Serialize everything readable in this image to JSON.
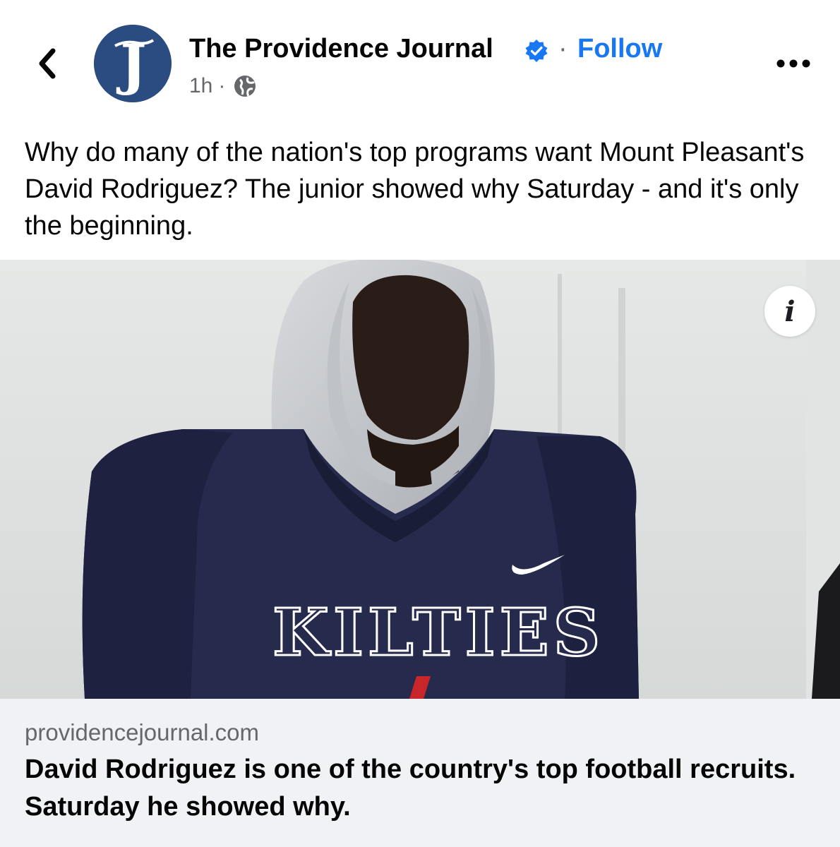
{
  "post": {
    "page_name": "The Providence Journal",
    "follow_label": "Follow",
    "separator": "·",
    "timestamp": "1h",
    "meta_separator": "·",
    "avatar_letter": "J",
    "text": "Why do many of the nation's top programs want Mount Pleasant's David Rodriguez? The junior showed why Saturday - and it's only the beginning."
  },
  "photo": {
    "jersey_text": "KILTIES",
    "info_icon": "i"
  },
  "link": {
    "domain": "providencejournal.com",
    "headline": "David Rodriguez is one of the country's top football recruits. Saturday he showed why."
  },
  "colors": {
    "accent": "#1877f2",
    "secondary_text": "#65676b",
    "jersey_navy": "#262a4c",
    "link_card_bg": "#f0f2f5"
  },
  "icons": {
    "back": "chevron-left-icon",
    "verified": "verified-badge-icon",
    "privacy": "globe-icon",
    "more": "more-horizontal-icon",
    "info": "info-icon"
  }
}
